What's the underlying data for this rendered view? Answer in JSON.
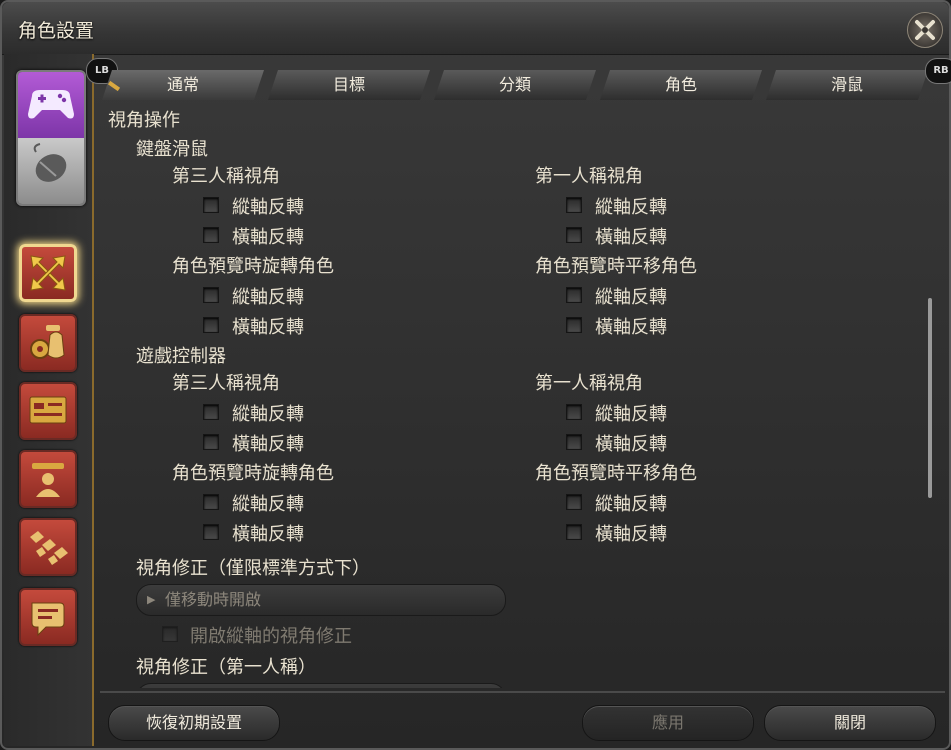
{
  "window": {
    "title": "角色設置"
  },
  "tabs": {
    "lb": "LB",
    "rb": "RB",
    "items": [
      {
        "label": "通常"
      },
      {
        "label": "目標"
      },
      {
        "label": "分類"
      },
      {
        "label": "角色"
      },
      {
        "label": "滑鼠"
      }
    ]
  },
  "content": {
    "section_title": "視角操作",
    "keyboard_mouse": {
      "label": "鍵盤滑鼠",
      "third_person": {
        "label": "第三人稱視角",
        "opt1": "縱軸反轉",
        "opt2": "橫軸反轉"
      },
      "first_person": {
        "label": "第一人稱視角",
        "opt1": "縱軸反轉",
        "opt2": "橫軸反轉"
      },
      "preview_rotate": {
        "label": "角色預覽時旋轉角色",
        "opt1": "縱軸反轉",
        "opt2": "橫軸反轉"
      },
      "preview_pan": {
        "label": "角色預覽時平移角色",
        "opt1": "縱軸反轉",
        "opt2": "橫軸反轉"
      }
    },
    "gamepad": {
      "label": "遊戲控制器",
      "third_person": {
        "label": "第三人稱視角",
        "opt1": "縱軸反轉",
        "opt2": "橫軸反轉"
      },
      "first_person": {
        "label": "第一人稱視角",
        "opt1": "縱軸反轉",
        "opt2": "橫軸反轉"
      },
      "preview_rotate": {
        "label": "角色預覽時旋轉角色",
        "opt1": "縱軸反轉",
        "opt2": "橫軸反轉"
      },
      "preview_pan": {
        "label": "角色預覽時平移角色",
        "opt1": "縱軸反轉",
        "opt2": "橫軸反轉"
      }
    },
    "camera_correction": {
      "label": "視角修正（僅限標準方式下）",
      "dropdown_value": "僅移動時開啟",
      "vertical_checkbox": "開啟縱軸的視角修正"
    },
    "camera_correction_fp": {
      "label": "視角修正（第一人稱）"
    }
  },
  "footer": {
    "reset": "恢復初期設置",
    "apply": "應用",
    "close": "關閉"
  },
  "colors": {
    "accent": "#f2d787",
    "category": "#b8382e",
    "gamepad": "#a04cc8"
  }
}
